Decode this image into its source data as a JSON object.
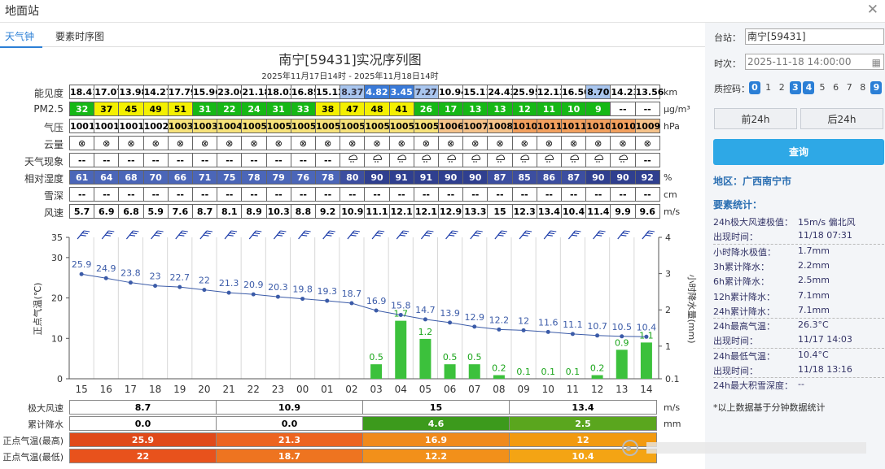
{
  "window": {
    "title": "地面站",
    "close_icon": "close-icon"
  },
  "tabs": [
    {
      "label": "天气钟"
    },
    {
      "label": "要素时序图"
    }
  ],
  "chart_title": "南宁[59431]实况序列图",
  "chart_subtitle": "2025年11月17日14时 - 2025年11月18日14时",
  "rows": {
    "vis": {
      "label": "能见度",
      "unit": "km",
      "values": [
        "18.41",
        "17.07",
        "13.98",
        "14.27",
        "17.79",
        "15.96",
        "23.06",
        "21.18",
        "18.03",
        "16.85",
        "15.12",
        "8.37",
        "4.82",
        "3.45",
        "7.27",
        "10.94",
        "15.11",
        "24.43",
        "25.95",
        "12.13",
        "16.50",
        "8.70",
        "14.23",
        "13.56"
      ]
    },
    "pm25": {
      "label": "PM2.5",
      "unit": "μg/m³",
      "values": [
        "32",
        "37",
        "45",
        "49",
        "51",
        "31",
        "22",
        "24",
        "31",
        "33",
        "38",
        "47",
        "48",
        "41",
        "26",
        "17",
        "13",
        "13",
        "12",
        "11",
        "10",
        "9",
        "--",
        "--"
      ]
    },
    "press": {
      "label": "气压",
      "unit": "hPa",
      "values": [
        "1001",
        "1001",
        "1001",
        "1002",
        "1003",
        "1003",
        "1004",
        "1005",
        "1005",
        "1005",
        "1005",
        "1005",
        "1005",
        "1005",
        "1005",
        "1006",
        "1007",
        "1008",
        "1010",
        "1011",
        "1011",
        "1010",
        "1010",
        "1009"
      ]
    },
    "cloud": {
      "label": "云量",
      "symbol": "⊗"
    },
    "wx": {
      "label": "天气现象",
      "values": [
        "--",
        "--",
        "--",
        "--",
        "--",
        "--",
        "--",
        "--",
        "--",
        "--",
        "--",
        "rain",
        "rain",
        "rain",
        "rain",
        "rain",
        "rain",
        "rain",
        "rain",
        "rain",
        "rain",
        "rain",
        "rain",
        "--"
      ]
    },
    "rh": {
      "label": "相对湿度",
      "unit": "%",
      "values": [
        "61",
        "64",
        "68",
        "70",
        "66",
        "71",
        "75",
        "78",
        "79",
        "76",
        "78",
        "80",
        "90",
        "91",
        "91",
        "90",
        "90",
        "87",
        "85",
        "86",
        "87",
        "90",
        "90",
        "92"
      ]
    },
    "snow": {
      "label": "雪深",
      "unit": "cm",
      "values": [
        "--",
        "--",
        "--",
        "--",
        "--",
        "--",
        "--",
        "--",
        "--",
        "--",
        "--",
        "--",
        "--",
        "--",
        "--",
        "--",
        "--",
        "--",
        "--",
        "--",
        "--",
        "--",
        "--",
        "--"
      ]
    },
    "wind": {
      "label": "风速",
      "unit": "m/s",
      "values": [
        "5.7",
        "6.9",
        "6.8",
        "5.9",
        "7.6",
        "8.7",
        "8.1",
        "8.9",
        "10.3",
        "8.8",
        "9.2",
        "10.9",
        "11.1",
        "12.1",
        "12.1",
        "12.9",
        "13.3",
        "15",
        "12.3",
        "13.4",
        "10.4",
        "11.4",
        "9.9",
        "9.6"
      ]
    }
  },
  "chart_data": {
    "type": "line",
    "x": [
      "15",
      "16",
      "17",
      "18",
      "19",
      "20",
      "21",
      "22",
      "23",
      "00",
      "01",
      "02",
      "03",
      "04",
      "05",
      "06",
      "07",
      "08",
      "09",
      "10",
      "11",
      "12",
      "13",
      "14"
    ],
    "series": [
      {
        "values": [
          25.9,
          24.9,
          23.8,
          23,
          22.7,
          22,
          21.3,
          20.9,
          20.3,
          19.8,
          19.3,
          18.7,
          16.9,
          15.8,
          14.7,
          13.9,
          12.9,
          12.2,
          12,
          11.6,
          11.1,
          10.7,
          10.5,
          10.4
        ]
      },
      {
        "values": [
          0,
          0,
          0,
          0,
          0,
          0,
          0,
          0,
          0,
          0,
          0,
          0,
          0.5,
          1.7,
          1.2,
          0.5,
          0.5,
          0.2,
          0.1,
          0.1,
          0.1,
          0.2,
          0.9,
          1.1
        ]
      }
    ],
    "ylabel": "正点气温(℃)",
    "y2label": "小时降水量(mm)",
    "ylim": [
      0,
      35
    ],
    "y2lim": [
      0.1,
      4
    ],
    "yticks": [
      "35",
      "30",
      "20",
      "10",
      "0"
    ],
    "y2ticks": [
      "4",
      "3",
      "2",
      "1",
      "0.1"
    ],
    "grid": true
  },
  "bottom": {
    "rows": [
      {
        "label": "极大风速",
        "unit": "m/s",
        "values": [
          "8.7",
          "10.9",
          "15",
          "13.4"
        ]
      },
      {
        "label": "累计降水",
        "unit": "mm",
        "values": [
          "0.0",
          "0.0",
          "4.6",
          "2.5"
        ]
      },
      {
        "label": "正点气温(最高)",
        "values": [
          "25.9",
          "21.3",
          "16.9",
          "12"
        ]
      },
      {
        "label": "正点气温(最低)",
        "values": [
          "22",
          "18.7",
          "12.2",
          "10.4"
        ]
      }
    ],
    "colors": {
      "precip": [
        "#ffffff",
        "#ffffff",
        "#3c9a1c",
        "#5aa61e"
      ],
      "tmax": [
        "#e04a1a",
        "#ec6420",
        "#f08a1c",
        "#f29a10"
      ],
      "tmin": [
        "#e8521c",
        "#ee7420",
        "#f2901a",
        "#f4a414"
      ]
    }
  },
  "panel": {
    "station_label": "台站：",
    "station_value": "南宁[59431]",
    "time_label": "时次：",
    "time_value": "2025-11-18 14:00:00",
    "qc_label": "质控码：",
    "qc_codes": [
      "0",
      "1",
      "2",
      "3",
      "4",
      "5",
      "6",
      "7",
      "8",
      "9"
    ],
    "qc_on": [
      "0",
      "3",
      "4",
      "9"
    ],
    "prev_label": "前24h",
    "next_label": "后24h",
    "query_label": "查询",
    "region": "地区：广西南宁市",
    "stats_title": "要素统计：",
    "stats": [
      {
        "k": "24h极大风速极值：",
        "v": "15m/s 偏北风"
      },
      {
        "k": "出现时间：",
        "v": "11/18 07:31"
      },
      {
        "k": "小时降水极值：",
        "v": "1.7mm"
      },
      {
        "k": "3h累计降水：",
        "v": "2.2mm"
      },
      {
        "k": "6h累计降水：",
        "v": "2.5mm"
      },
      {
        "k": "12h累计降水：",
        "v": "7.1mm"
      },
      {
        "k": "24h累计降水：",
        "v": "7.1mm"
      },
      {
        "k": "24h最高气温：",
        "v": "26.3°C"
      },
      {
        "k": "出现时间：",
        "v": "11/17 14:03"
      },
      {
        "k": "24h最低气温：",
        "v": "10.4°C"
      },
      {
        "k": "出现时间：",
        "v": "11/18 13:16"
      },
      {
        "k": "24h最大积雪深度：",
        "v": "--"
      }
    ],
    "note": "*以上数据基于分钟数据统计"
  }
}
